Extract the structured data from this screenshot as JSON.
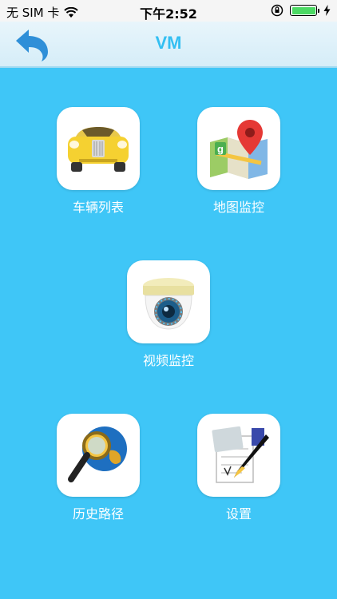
{
  "status_bar": {
    "carrier": "无 SIM 卡",
    "time": "下午2:52",
    "icons": [
      "wifi-icon",
      "rotation-lock-icon",
      "battery-icon",
      "charging-icon"
    ]
  },
  "nav": {
    "title": "VM",
    "back_icon": "back-arrow-icon"
  },
  "menu": {
    "vehicle_list": {
      "label": "车辆列表",
      "icon": "car-icon"
    },
    "map_monitor": {
      "label": "地图监控",
      "icon": "map-icon"
    },
    "video_monitor": {
      "label": "视频监控",
      "icon": "camera-icon"
    },
    "history_route": {
      "label": "历史路径",
      "icon": "globe-magnifier-icon"
    },
    "settings": {
      "label": "设置",
      "icon": "pen-document-icon"
    }
  },
  "colors": {
    "background": "#3fc6f7",
    "title": "#33bff2",
    "back_arrow": "#2f8fd8"
  }
}
